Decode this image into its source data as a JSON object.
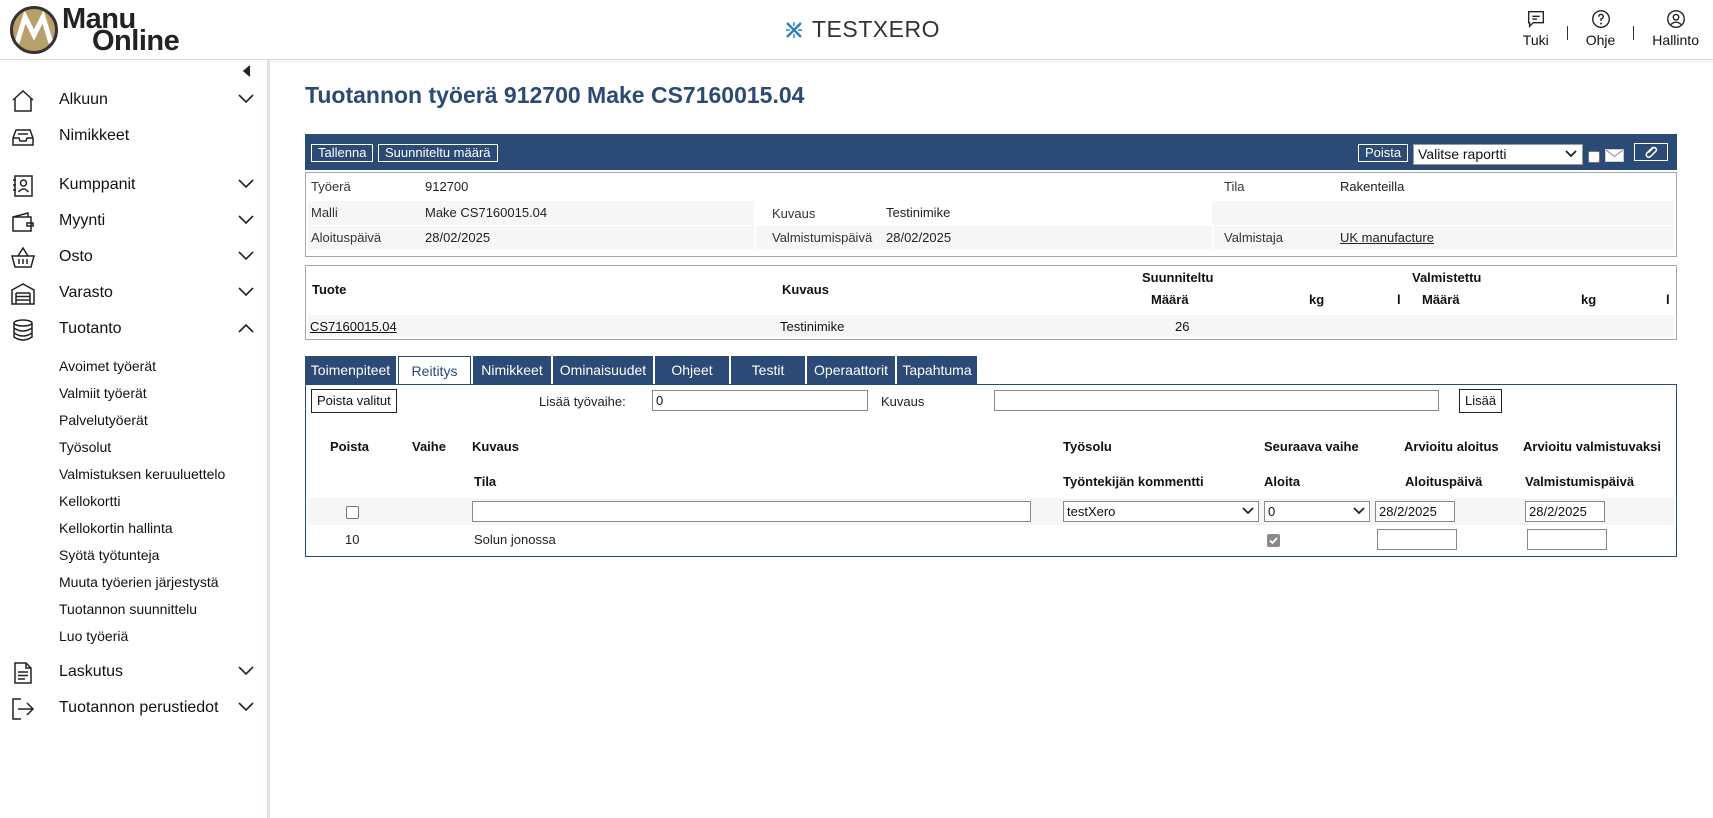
{
  "header": {
    "logo_line1": "Manu",
    "logo_line2": "Online",
    "brand": "TESTXERO",
    "actions": {
      "support": "Tuki",
      "help": "Ohje",
      "admin": "Hallinto"
    }
  },
  "sidebar": {
    "items": [
      {
        "label": "Alkuun",
        "icon": "home-icon"
      },
      {
        "label": "Nimikkeet",
        "icon": "inbox-icon"
      },
      {
        "label": "Kumppanit",
        "icon": "contacts-icon"
      },
      {
        "label": "Myynti",
        "icon": "wallet-icon"
      },
      {
        "label": "Osto",
        "icon": "basket-icon"
      },
      {
        "label": "Varasto",
        "icon": "warehouse-icon"
      },
      {
        "label": "Tuotanto",
        "icon": "database-icon"
      },
      {
        "label": "Laskutus",
        "icon": "document-icon"
      },
      {
        "label": "Tuotannon perustiedot",
        "icon": "exit-icon"
      }
    ],
    "sub_items": [
      "Avoimet työerät",
      "Valmiit työerät",
      "Palvelutyöerät",
      "Työsolut",
      "Valmistuksen keruuluettelo",
      "Kellokortti",
      "Kellokortin hallinta",
      "Syötä työtunteja",
      "Muuta työerien järjestystä",
      "Tuotannon suunnittelu",
      "Luo työeriä"
    ]
  },
  "page": {
    "title": "Tuotannon työerä 912700 Make CS7160015.04"
  },
  "toolbar": {
    "save": "Tallenna",
    "planned_qty": "Suunniteltu määrä",
    "delete": "Poista",
    "report_select": "Valitse raportti"
  },
  "info": {
    "batch_label": "Työerä",
    "batch_value": "912700",
    "state_label": "Tila",
    "state_value": "Rakenteilla",
    "model_label": "Malli",
    "model_value": "Make CS7160015.04",
    "desc_label": "Kuvaus",
    "desc_value": "Testinimike",
    "start_label": "Aloituspäivä",
    "start_value": "28/02/2025",
    "finish_label": "Valmistumispäivä",
    "finish_value": "28/02/2025",
    "maker_label": "Valmistaja",
    "maker_value": "UK manufacture"
  },
  "product": {
    "col_product": "Tuote",
    "col_desc": "Kuvaus",
    "planned": "Suunniteltu",
    "made": "Valmistettu",
    "qty": "Määrä",
    "kg": "kg",
    "l": "l",
    "row": {
      "product": "CS7160015.04",
      "desc": "Testinimike",
      "planned_qty": "26"
    }
  },
  "tabs": [
    "Toimenpiteet",
    "Reititys",
    "Nimikkeet",
    "Ominaisuudet",
    "Ohjeet",
    "Testit",
    "Operaattorit",
    "Tapahtuma"
  ],
  "routing": {
    "delete_selected": "Poista valitut",
    "add_phase_label": "Lisää työvaihe:",
    "add_phase_value": "0",
    "desc_label": "Kuvaus",
    "desc_value": "",
    "add_button": "Lisää",
    "headers": {
      "delete": "Poista",
      "phase": "Vaihe",
      "desc": "Kuvaus",
      "workcell": "Työsolu",
      "next_phase": "Seuraava vaihe",
      "est_start": "Arvioitu aloitus",
      "est_finish": "Arvioitu valmistuvaksi",
      "state": "Tila",
      "worker_comment": "Työntekijän kommentti",
      "start": "Aloita",
      "start_date": "Aloituspäivä",
      "finish_date": "Valmistumispäivä"
    },
    "row": {
      "desc": "",
      "workcell": "testXero",
      "next_phase": "0",
      "est_start": "28/2/2025",
      "est_finish": "28/2/2025",
      "phase": "10",
      "state": "Solun jonossa",
      "start_date": "",
      "finish_date": ""
    }
  }
}
